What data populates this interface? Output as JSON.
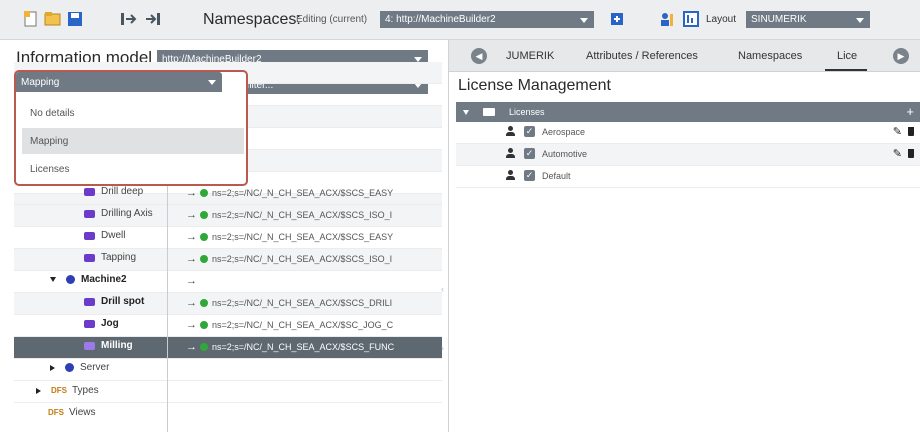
{
  "toolbar": {
    "namespaces_label": "Namespaces:",
    "editing_label": "Editing (current)",
    "namespace_value": "4: http://MachineBuilder2",
    "layout_label": "Layout",
    "layout_value": "SINUMERIK"
  },
  "info_model": {
    "title": "Information model",
    "model_value": "http://MachineBuilder2",
    "filter_selected": "Mapping",
    "filter2_value": "No filter...",
    "filter_options": [
      "No details",
      "Mapping",
      "Licenses"
    ],
    "tree": [
      {
        "label": "Drill deep",
        "mapping": "ns=2;s=/NC/_N_CH_SEA_ACX/$SCS_EASY"
      },
      {
        "label": "Drilling Axis",
        "mapping": "ns=2;s=/NC/_N_CH_SEA_ACX/$SCS_ISO_I"
      },
      {
        "label": "Dwell",
        "mapping": "ns=2;s=/NC/_N_CH_SEA_ACX/$SCS_EASY"
      },
      {
        "label": "Tapping",
        "mapping": "ns=2;s=/NC/_N_CH_SEA_ACX/$SCS_ISO_I"
      },
      {
        "label": "Machine2",
        "mapping": ""
      },
      {
        "label": "Drill spot",
        "mapping": "ns=2;s=/NC/_N_CH_SEA_ACX/$SCS_DRILI"
      },
      {
        "label": "Jog",
        "mapping": "ns=2;s=/NC/_N_CH_SEA_ACX/$SC_JOG_C"
      },
      {
        "label": "Milling",
        "mapping": "ns=2;s=/NC/_N_CH_SEA_ACX/$SCS_FUNC"
      },
      {
        "label": "Server",
        "mapping": ""
      },
      {
        "label": "Types",
        "mapping": ""
      },
      {
        "label": "Views",
        "mapping": ""
      }
    ],
    "folder_icon_text": "DFS"
  },
  "right_pane": {
    "tabs": [
      "JUMERIK",
      "Attributes / References",
      "Namespaces",
      "Lice"
    ],
    "title": "License Management",
    "licenses_header": "Licenses",
    "licenses": [
      "Aerospace",
      "Automotive",
      "Default"
    ]
  },
  "colors": {
    "accent": "#6f7a85",
    "selected_row": "#5e6870",
    "popup_border": "#b85a4e",
    "method_icon": "#6b3cc9",
    "object_icon": "#2d3fb3",
    "mapped_dot": "#2fa83a"
  }
}
